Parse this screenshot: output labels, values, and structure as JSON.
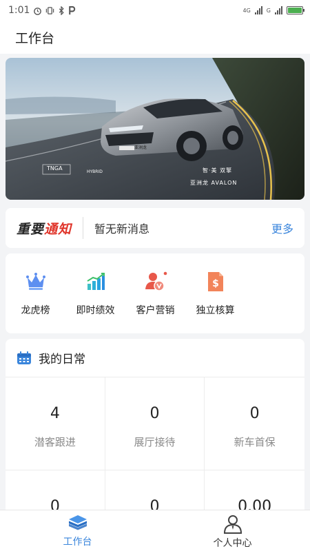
{
  "status_bar": {
    "time": "1:01",
    "network_1": "4G",
    "network_2": "G",
    "battery_level": 1.0
  },
  "header": {
    "title": "工作台"
  },
  "banner": {
    "tagline": "智·美 双擎",
    "model_name": "亚洲龙 AVALON",
    "plate": "亚洲龙",
    "badge_hybrid": "HYBRID",
    "badge_left": "TNGA"
  },
  "notice": {
    "brand_part1": "重要",
    "brand_part2": "通知",
    "message": "暂无新消息",
    "more": "更多"
  },
  "quick_actions": [
    {
      "label": "龙虎榜",
      "icon": "crown-icon"
    },
    {
      "label": "即时绩效",
      "icon": "bar-chart-icon"
    },
    {
      "label": "客户营销",
      "icon": "customer-icon"
    },
    {
      "label": "独立核算",
      "icon": "dollar-document-icon"
    }
  ],
  "daily": {
    "title": "我的日常",
    "stats": [
      {
        "value": "4",
        "label": "潜客跟进"
      },
      {
        "value": "0",
        "label": "展厅接待"
      },
      {
        "value": "0",
        "label": "新车首保"
      },
      {
        "value": "0",
        "label": ""
      },
      {
        "value": "0",
        "label": ""
      },
      {
        "value": "0.00",
        "label": ""
      }
    ]
  },
  "tabbar": {
    "tabs": [
      {
        "label": "工作台",
        "active": true,
        "icon": "stack-layers-icon"
      },
      {
        "label": "个人中心",
        "active": false,
        "icon": "person-icon"
      }
    ]
  },
  "colors": {
    "accent": "#3b86dc",
    "brand_red": "#e0352b",
    "background": "#f3f4f6"
  }
}
